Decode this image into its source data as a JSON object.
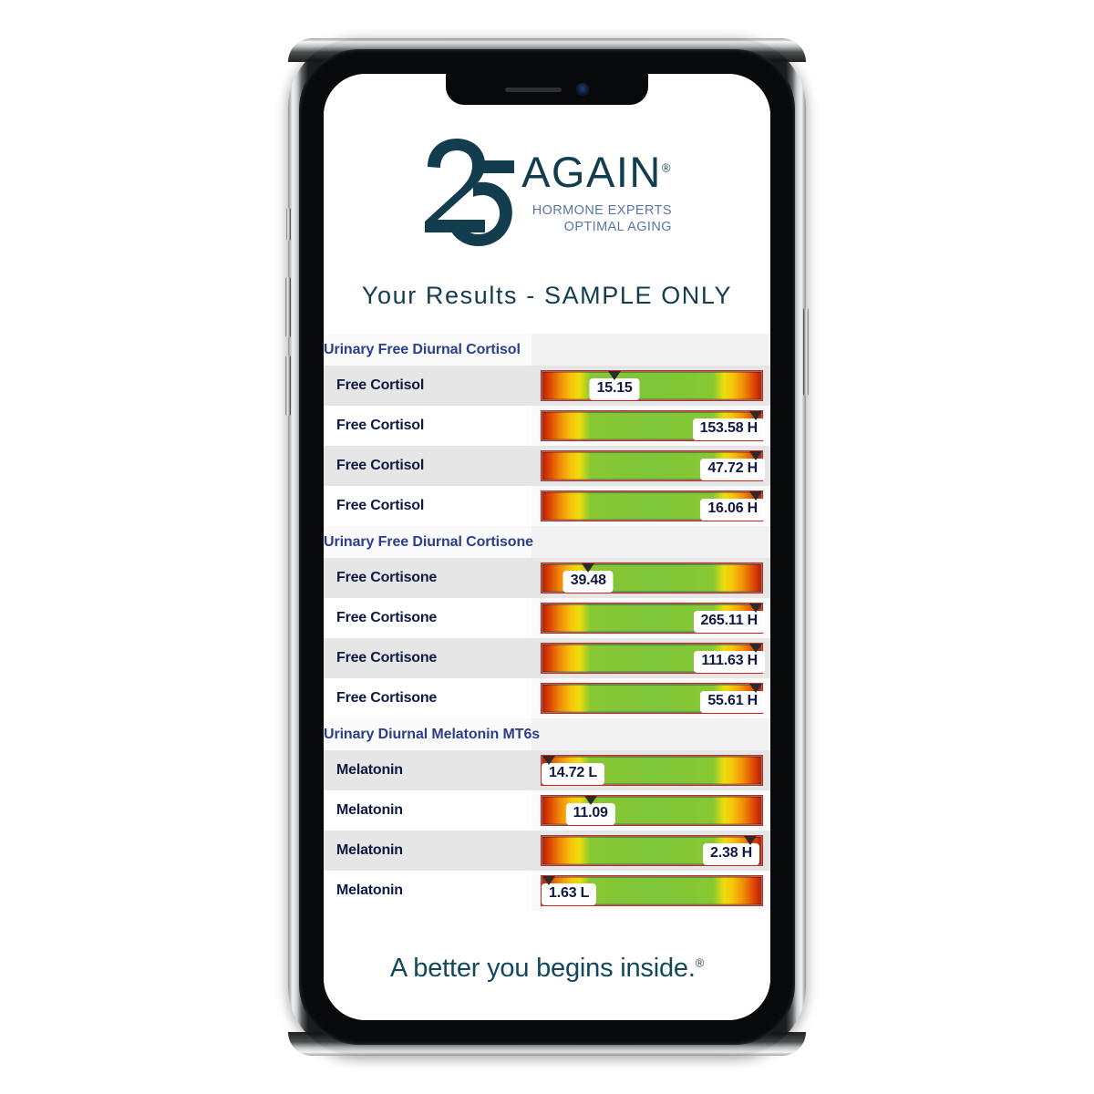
{
  "device": {
    "type": "smartphone-mockup",
    "notch": {
      "speaker": "speaker-grille",
      "camera": "front-camera"
    },
    "buttons": [
      "silent-switch",
      "volume-up",
      "volume-down",
      "power"
    ]
  },
  "brand": {
    "mark_text": "25",
    "name": "AGAIN",
    "registered_mark": "®",
    "tagline_line1": "HORMONE EXPERTS",
    "tagline_line2": "OPTIMAL AGING",
    "logo_color": "#123d4e",
    "tagline_color": "#5a76a8"
  },
  "headline": "Your Results - SAMPLE ONLY",
  "footer": {
    "tagline": "A better you begins inside.",
    "registered_mark": "®"
  },
  "colors": {
    "section_header_text": "#2b3f8c",
    "row_label_text": "#101944",
    "gauge_low": "#c01d05",
    "gauge_mid": "#f7c40a",
    "gauge_normal": "#7ec63a",
    "marker": "#2b2b2b"
  },
  "results": {
    "sections": [
      {
        "title": "Urinary Free Diurnal Cortisol",
        "rows": [
          {
            "label": "Free Cortisol",
            "value": "15.15",
            "flag": "",
            "marker_pct": 33,
            "label_align": "center",
            "label_left_pct": 33
          },
          {
            "label": "Free Cortisol",
            "value": "153.58 H",
            "flag": "H",
            "marker_pct": 97.5,
            "label_align": "right",
            "label_left_pct": 97.5
          },
          {
            "label": "Free Cortisol",
            "value": "47.72 H",
            "flag": "H",
            "marker_pct": 97.5,
            "label_align": "right",
            "label_left_pct": 97.5
          },
          {
            "label": "Free Cortisol",
            "value": "16.06 H",
            "flag": "H",
            "marker_pct": 97.5,
            "label_align": "right",
            "label_left_pct": 97.5
          }
        ]
      },
      {
        "title": "Urinary Free Diurnal Cortisone",
        "rows": [
          {
            "label": "Free Cortisone",
            "value": "39.48",
            "flag": "",
            "marker_pct": 21,
            "label_align": "center",
            "label_left_pct": 21
          },
          {
            "label": "Free Cortisone",
            "value": "265.11 H",
            "flag": "H",
            "marker_pct": 97.5,
            "label_align": "right",
            "label_left_pct": 97.5
          },
          {
            "label": "Free Cortisone",
            "value": "111.63 H",
            "flag": "H",
            "marker_pct": 97.5,
            "label_align": "right",
            "label_left_pct": 97.5
          },
          {
            "label": "Free Cortisone",
            "value": "55.61 H",
            "flag": "H",
            "marker_pct": 97.5,
            "label_align": "right",
            "label_left_pct": 97.5
          }
        ]
      },
      {
        "title": "Urinary Diurnal Melatonin MT6s",
        "rows": [
          {
            "label": "Melatonin",
            "value": "14.72 L",
            "flag": "L",
            "marker_pct": 3,
            "label_align": "left",
            "label_left_pct": 3
          },
          {
            "label": "Melatonin",
            "value": "11.09",
            "flag": "",
            "marker_pct": 22,
            "label_align": "center",
            "label_left_pct": 22
          },
          {
            "label": "Melatonin",
            "value": "2.38 H",
            "flag": "H",
            "marker_pct": 95,
            "label_align": "right",
            "label_left_pct": 95
          },
          {
            "label": "Melatonin",
            "value": "1.63 L",
            "flag": "L",
            "marker_pct": 3,
            "label_align": "left",
            "label_left_pct": 3
          }
        ]
      }
    ]
  }
}
